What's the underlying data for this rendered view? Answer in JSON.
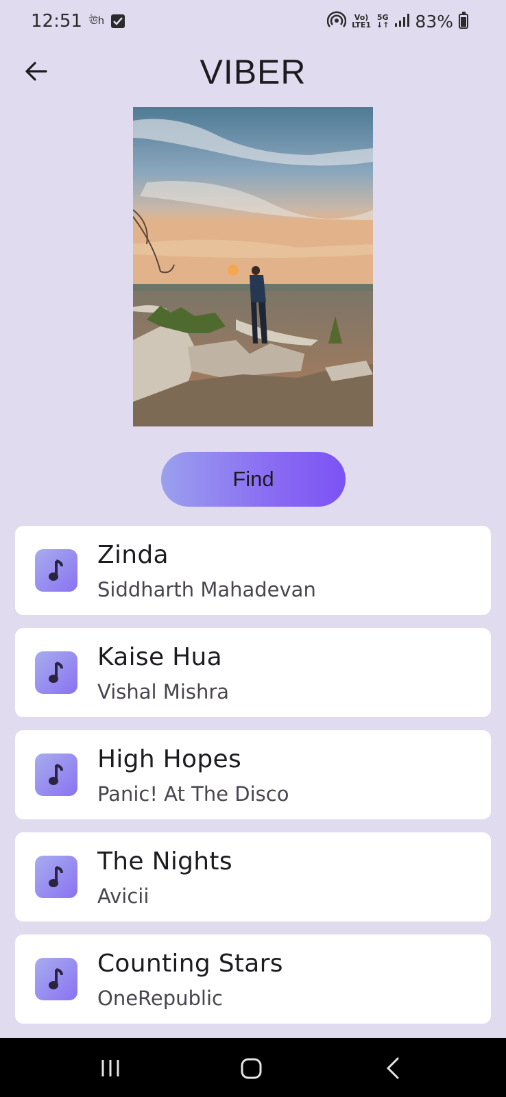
{
  "status_bar": {
    "time": "12:51",
    "carrier_glyph": "ঊh",
    "net_top": "Vo)",
    "net_bottom": "LTE1",
    "net_5g": "5G",
    "battery": "83%"
  },
  "app_bar": {
    "title": "VIBER",
    "back_icon": "arrow-left-icon"
  },
  "photo": {
    "description_icon": "landscape-photo"
  },
  "find_button": {
    "label": "Find"
  },
  "songs": [
    {
      "title": "Zinda",
      "artist": "Siddharth Mahadevan"
    },
    {
      "title": "Kaise Hua",
      "artist": "Vishal Mishra"
    },
    {
      "title": "High Hopes",
      "artist": "Panic! At The Disco"
    },
    {
      "title": "The Nights",
      "artist": "Avicii"
    },
    {
      "title": "Counting Stars",
      "artist": "OneRepublic"
    }
  ],
  "colors": {
    "background": "#e1dbef",
    "accent_start": "#9aa0ee",
    "accent_end": "#7c52f4",
    "card": "#ffffff"
  }
}
